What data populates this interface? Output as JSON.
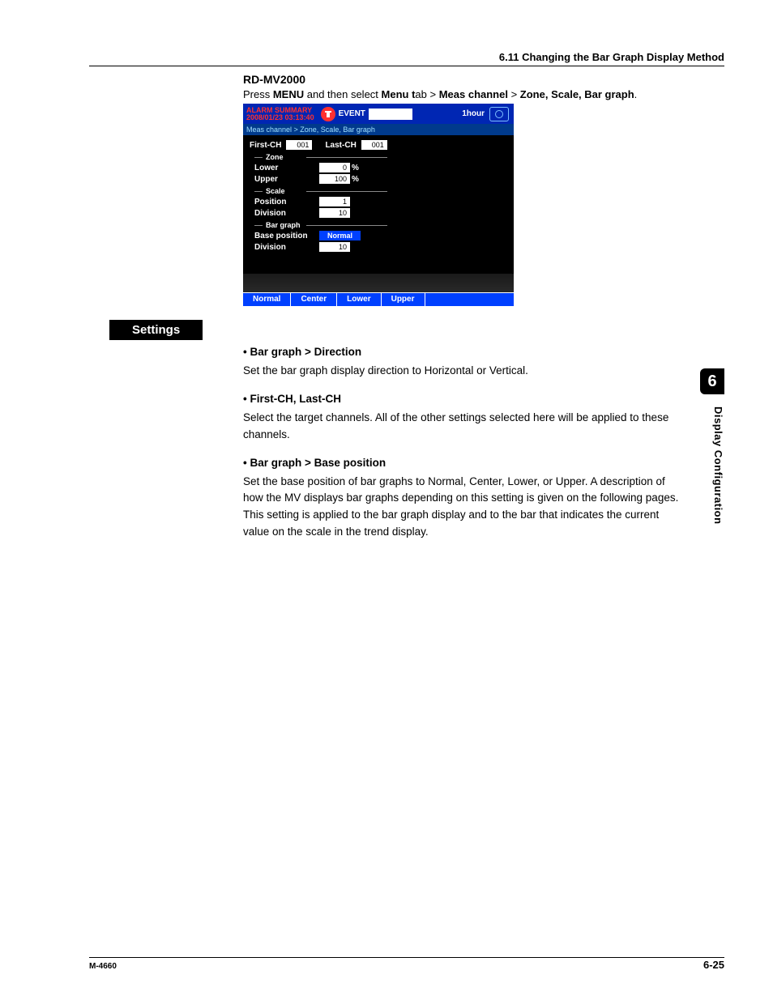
{
  "header": {
    "title": "6.11  Changing the Bar Graph Display Method"
  },
  "model": "RD-MV2000",
  "press": {
    "pre": "Press ",
    "menu": "MENU",
    "mid1": " and then select ",
    "menutab": "Menu t",
    "ab": "ab > ",
    "meas": "Meas channel",
    "gt": " > ",
    "zone": "Zone, Scale, Bar graph",
    "dot": "."
  },
  "device": {
    "alarm_l1": "ALARM SUMMARY",
    "alarm_l2": "2008/01/23 03:13:40",
    "event": "EVENT",
    "hour": "1hour",
    "breadcrumb": "Meas channel > Zone, Scale, Bar graph",
    "first_lbl": "First-CH",
    "first_val": "001",
    "last_lbl": "Last-CH",
    "last_val": "001",
    "zone_title": "Zone",
    "zone_lower_lbl": "Lower",
    "zone_lower_val": "0",
    "zone_upper_lbl": "Upper",
    "zone_upper_val": "100",
    "pct": "%",
    "scale_title": "Scale",
    "scale_pos_lbl": "Position",
    "scale_pos_val": "1",
    "scale_div_lbl": "Division",
    "scale_div_val": "10",
    "bg_title": "Bar graph",
    "bg_base_lbl": "Base position",
    "bg_base_val": "Normal",
    "bg_div_lbl": "Division",
    "bg_div_val": "10",
    "foot": {
      "normal": "Normal",
      "center": "Center",
      "lower": "Lower",
      "upper": "Upper"
    }
  },
  "settings_label": "Settings",
  "items": [
    {
      "title": "Bar graph > Direction",
      "body": "Set the bar graph display direction to Horizontal or Vertical."
    },
    {
      "title": "First-CH, Last-CH",
      "body": "Select the target channels. All of the other settings selected here will be applied to these channels."
    },
    {
      "title": "Bar graph > Base position",
      "body": "Set the base position of bar graphs to Normal, Center, Lower, or Upper. A description of how the MV displays bar graphs depending on this setting is given on the following pages. This setting is applied to the bar graph display and to the bar that indicates the current value on the scale in the trend display."
    }
  ],
  "chapter": {
    "num": "6",
    "title": "Display Configuration"
  },
  "footer": {
    "left": "M-4660",
    "right": "6-25"
  }
}
